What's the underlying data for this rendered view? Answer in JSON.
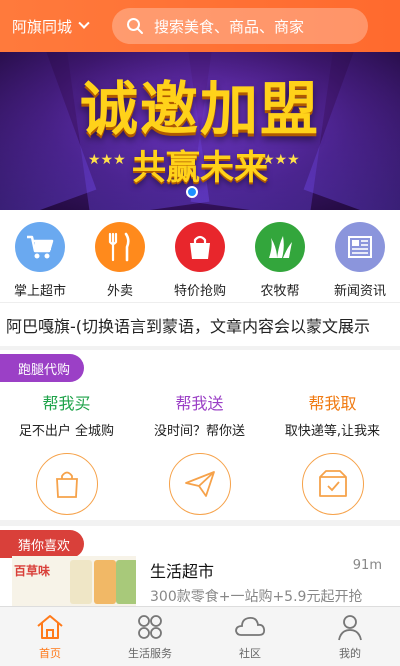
{
  "header": {
    "city": "阿旗同城",
    "search_placeholder": "搜索美食、商品、商家"
  },
  "banner": {
    "title": "诚邀加盟",
    "subtitle": "共赢未来"
  },
  "categories": [
    {
      "label": "掌上超市",
      "icon": "cart-icon",
      "color": "#6aa9f0"
    },
    {
      "label": "外卖",
      "icon": "fork-knife-icon",
      "color": "#ff8a1c"
    },
    {
      "label": "特价抢购",
      "icon": "shopping-bag-icon",
      "color": "#e8262c"
    },
    {
      "label": "农牧帮",
      "icon": "grass-icon",
      "color": "#33a63c"
    },
    {
      "label": "新闻资讯",
      "icon": "newspaper-icon",
      "color": "#8b95dc"
    }
  ],
  "notice": "阿巴嘎旗-(切换语言到蒙语，文章内容会以蒙文展示",
  "errand": {
    "tag": "跑腿代购",
    "items": [
      {
        "title": "帮我买",
        "desc": "足不出户 全城购",
        "color": "#1fa34a",
        "icon": "shopping-bag-icon"
      },
      {
        "title": "帮我送",
        "desc": "没时间？帮你送",
        "color": "#9b40c6",
        "icon": "paper-plane-icon"
      },
      {
        "title": "帮我取",
        "desc": "取快递等,让我来",
        "color": "#f07a12",
        "icon": "parcel-box-icon"
      }
    ]
  },
  "guess": {
    "tag": "猜你喜欢",
    "shop": {
      "brand": "百草味",
      "name": "生活超市",
      "distance": "91m",
      "desc": "300款零食+一站购+5.9元起开抢"
    }
  },
  "nav": [
    {
      "label": "首页",
      "icon": "home-icon",
      "active": true
    },
    {
      "label": "生活服务",
      "icon": "grid-icon",
      "active": false
    },
    {
      "label": "社区",
      "icon": "cloud-icon",
      "active": false
    },
    {
      "label": "我的",
      "icon": "user-icon",
      "active": false
    }
  ],
  "colors": {
    "accent": "#ff7a3c",
    "active_nav": "#ff7a1a",
    "ring": "#f6a24a"
  }
}
